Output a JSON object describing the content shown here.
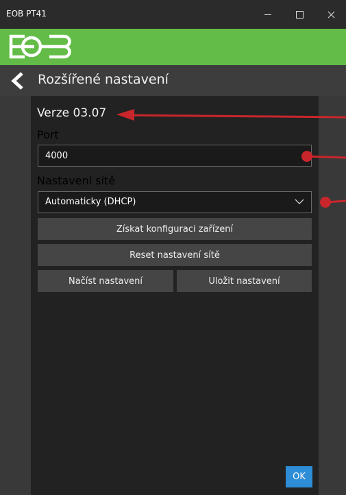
{
  "window": {
    "title": "EOB PT41",
    "minimize_icon": "minimize-icon",
    "maximize_icon": "maximize-icon",
    "close_icon": "close-icon"
  },
  "brand": {
    "logo": "EOB logo"
  },
  "header": {
    "back_icon": "chevron-left-icon",
    "title": "Rozšířené nastavení"
  },
  "content": {
    "version": "Verze 03.07",
    "port_label": "Port",
    "port_value": "4000",
    "network_label": "Nastavení sítě",
    "network_value": "Automaticky (DHCP)",
    "get_config_button": "Získat konfiguraci zařízení",
    "reset_network_button": "Reset nastavení sítě",
    "load_settings_button": "Načíst nastavení",
    "save_settings_button": "Uložit nastavení",
    "ok_button": "OK"
  },
  "colors": {
    "brand_green": "#62bc47",
    "accent_blue": "#2d8dd6",
    "annotation_red": "#c9262c"
  }
}
